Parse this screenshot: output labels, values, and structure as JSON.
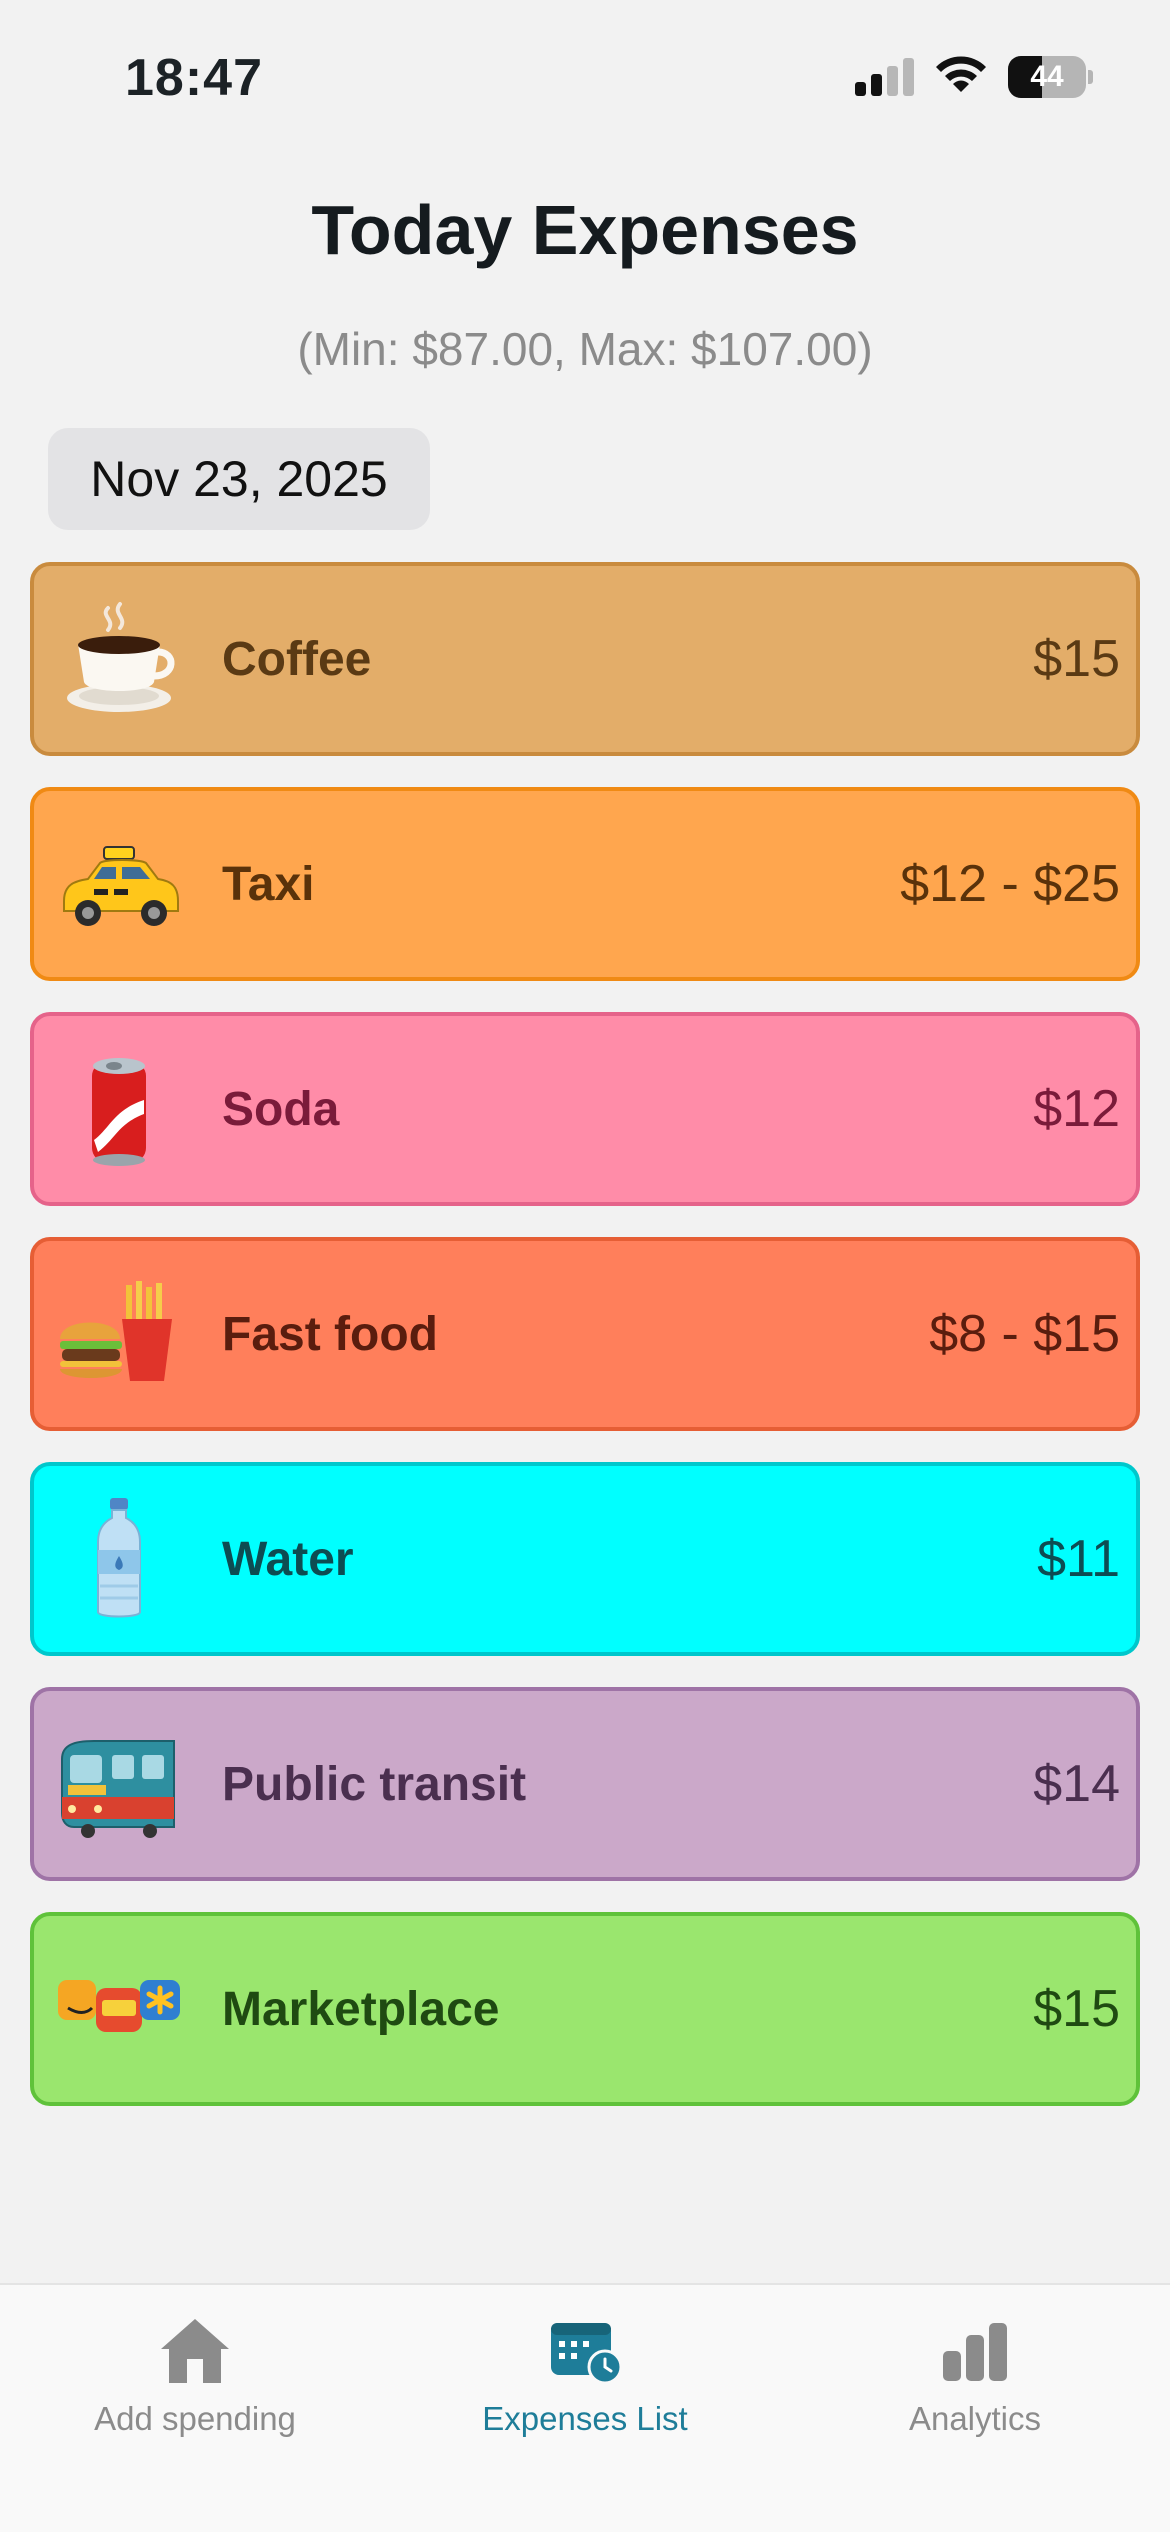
{
  "status_bar": {
    "time": "18:47",
    "battery_level": "44",
    "battery_fraction": 0.44,
    "signal_bars_active": 2,
    "signal_bars_total": 4
  },
  "header": {
    "title": "Today Expenses",
    "range": "(Min: $87.00, Max: $107.00)",
    "date": "Nov 23, 2025"
  },
  "expenses": [
    {
      "icon": "coffee-cup-icon",
      "name": "Coffee",
      "amount": "$15",
      "bg": "#e3ad69",
      "border": "#c98b3e",
      "text": "#5a3a14"
    },
    {
      "icon": "taxi-icon",
      "name": "Taxi",
      "amount": "$12 - $25",
      "bg": "#ffa64e",
      "border": "#f08a14",
      "text": "#5a320a"
    },
    {
      "icon": "soda-can-icon",
      "name": "Soda",
      "amount": "$12",
      "bg": "#ff8ca8",
      "border": "#e5638a",
      "text": "#7a1b3a"
    },
    {
      "icon": "burger-fries-icon",
      "name": "Fast food",
      "amount": "$8 - $15",
      "bg": "#ff7f5b",
      "border": "#e65e35",
      "text": "#5a1d0e"
    },
    {
      "icon": "water-bottle-icon",
      "name": "Water",
      "amount": "$11",
      "bg": "#00ffff",
      "border": "#00c7cc",
      "text": "#0d4c52"
    },
    {
      "icon": "metro-train-icon",
      "name": "Public transit",
      "amount": "$14",
      "bg": "#cba8c9",
      "border": "#9f73a6",
      "text": "#4a2f4f"
    },
    {
      "icon": "marketplace-logos-icon",
      "name": "Marketplace",
      "amount": "$15",
      "bg": "#9ae66e",
      "border": "#5fc23a",
      "text": "#1f4a12"
    }
  ],
  "tabs": [
    {
      "icon": "home-icon",
      "label": "Add spending",
      "active": false
    },
    {
      "icon": "calendar-clock-icon",
      "label": "Expenses List",
      "active": true
    },
    {
      "icon": "bar-chart-icon",
      "label": "Analytics",
      "active": false
    }
  ],
  "colors": {
    "accent": "#1e7d99",
    "inactive": "#8b8b8b"
  }
}
